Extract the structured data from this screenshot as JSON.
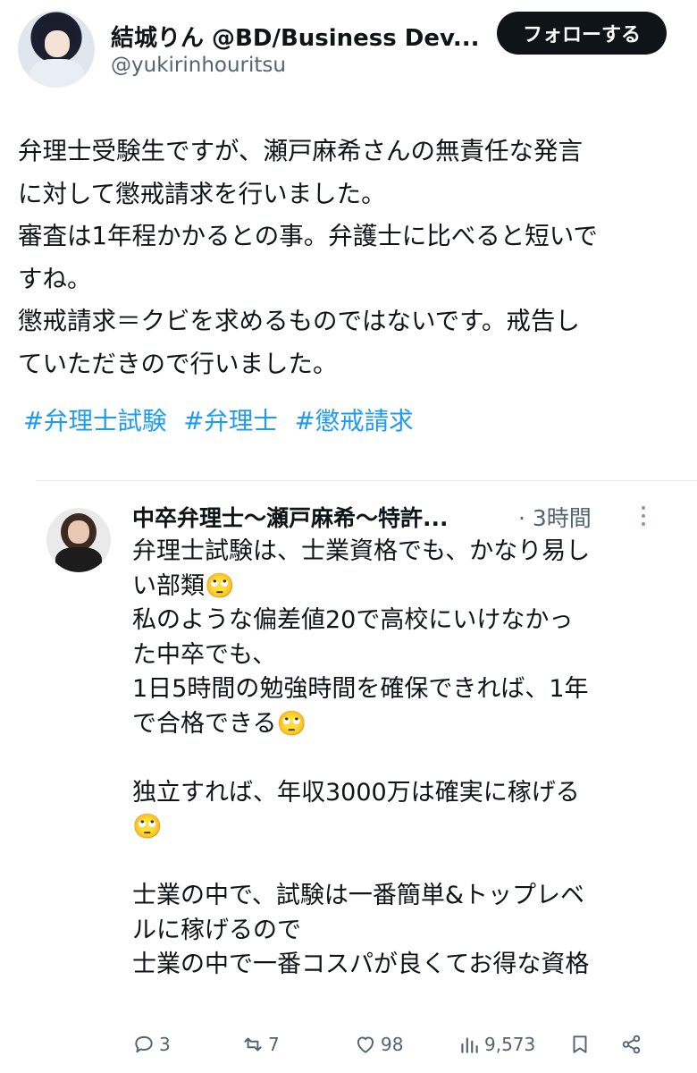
{
  "author": {
    "display_name": "結城りん @BD/Business Dev...",
    "handle": "@yukirinhouritsu",
    "follow_label": "フォローする"
  },
  "tweet": {
    "lines": [
      "弁理士受験生ですが、瀬戸麻希さんの無責任な発言",
      "に対して懲戒請求を行いました。",
      "審査は1年程かかるとの事。弁護士に比べると短いで",
      "すね。",
      "懲戒請求＝クビを求めるものではないです。戒告し",
      "ていただきので行いました。"
    ],
    "hashtags": [
      "#弁理士試験",
      "#弁理士",
      "#懲戒請求"
    ]
  },
  "quoted": {
    "name": "中卒弁理士〜瀬戸麻希〜特許...",
    "time": "· 3時間",
    "lines": [
      "弁理士試験は、士業資格でも、かなり易し",
      "い部類🙄",
      "私のような偏差値20で高校にいけなかっ",
      "た中卒でも、",
      "1日5時間の勉強時間を確保できれば、1年",
      "で合格できる🙄",
      "",
      "独立すれば、年収3000万は確実に稼げる",
      "🙄",
      "",
      "士業の中で、試験は一番簡単&トップレベ",
      "ルに稼げるので",
      "士業の中で一番コスパが良くてお得な資格"
    ]
  },
  "actions": {
    "replies": "3",
    "reposts": "7",
    "likes": "98",
    "views": "9,573"
  }
}
